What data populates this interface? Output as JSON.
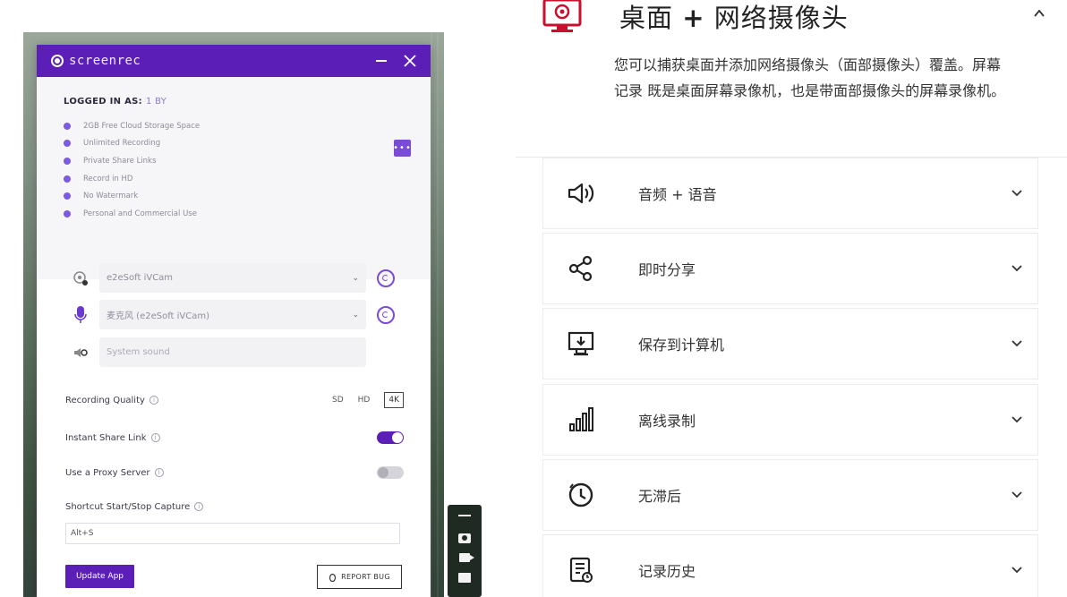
{
  "screenrec": {
    "app_name": "screenrec",
    "logged_in_label": "LOGGED IN AS:",
    "username": "1 BY",
    "features": [
      "2GB Free Cloud Storage Space",
      "Unlimited Recording",
      "Private Share Links",
      "Record in HD",
      "No Watermark",
      "Personal and Commercial Use"
    ],
    "camera_source": "e2eSoft iVCam",
    "mic_source": "麦克风 (e2eSoft iVCam)",
    "system_sound_placeholder": "System sound",
    "recording_quality_label": "Recording Quality",
    "quality_options": [
      "SD",
      "HD",
      "4K"
    ],
    "quality_selected": "4K",
    "instant_share_label": "Instant Share Link",
    "instant_share_on": true,
    "proxy_label": "Use a Proxy Server",
    "proxy_on": false,
    "shortcut_label": "Shortcut Start/Stop Capture",
    "shortcut_value": "Alt+S",
    "update_button": "Update App",
    "report_bug_button": "REPORT BUG"
  },
  "feature_section": {
    "title_part1": "桌面",
    "title_plus": "+",
    "title_part2": "网络摄像头",
    "description": "您可以捕获桌面并添加网络摄像头（面部摄像头）覆盖。屏幕记录 既是桌面屏幕录像机，也是带面部摄像头的屏幕录像机。",
    "accent_color": "#c8102e"
  },
  "accordion": [
    {
      "label": "音频 + 语音",
      "icon": "speaker-icon"
    },
    {
      "label": "即时分享",
      "icon": "share-icon"
    },
    {
      "label": "保存到计算机",
      "icon": "save-to-computer-icon"
    },
    {
      "label": "离线录制",
      "icon": "signal-bars-icon"
    },
    {
      "label": "无滞后",
      "icon": "clock-icon"
    },
    {
      "label": "记录历史",
      "icon": "history-document-icon"
    }
  ]
}
